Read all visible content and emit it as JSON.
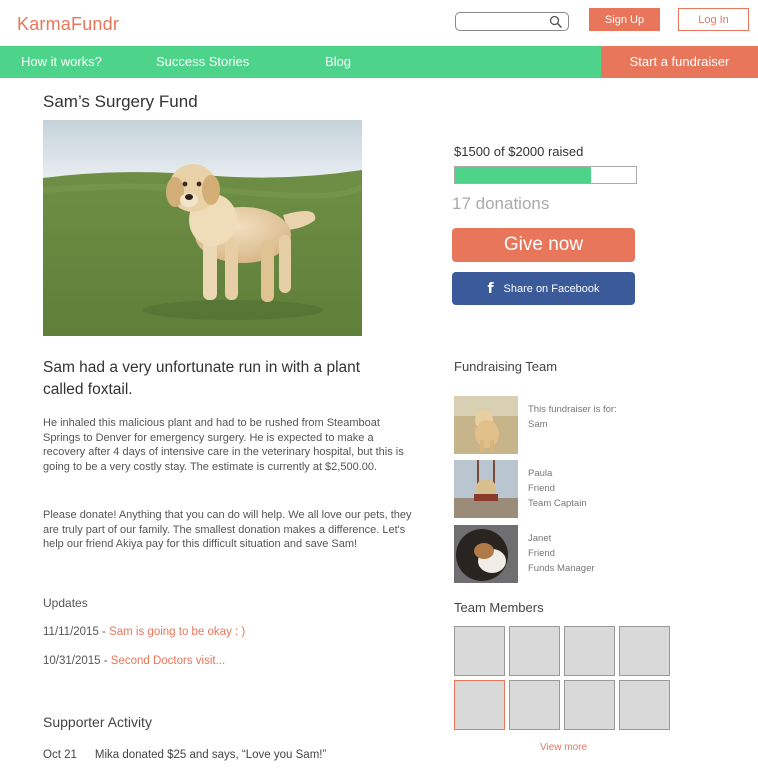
{
  "header": {
    "logo": "KarmaFundr",
    "search_placeholder": "",
    "signup_label": "Sign Up",
    "login_label": "Log In"
  },
  "nav": {
    "items": [
      "How it works?",
      "Success Stories",
      "Blog"
    ],
    "cta": "Start a fundraiser"
  },
  "campaign": {
    "title": "Sam’s Surgery Fund",
    "raised_text": "$1500 of $2000 raised",
    "progress_fraction": 0.75,
    "donations": "17 donations",
    "give_label": "Give now",
    "share_label": "Share on Facebook",
    "headline": "Sam had a very unfortunate run in with a plant called foxtail.",
    "paragraph1": "He inhaled this malicious plant and had to be rushed from Steamboat Springs to Denver for emergency surgery. He is expected to make a recovery after 4 days of intensive care in the veterinary hospital, but this is going to be a very costly stay. The estimate is currently at $2,500.00.",
    "paragraph2": "Please donate! Anything that you can do will help. We all love our pets, they are truly part of our family. The smallest donation makes a difference. Let's help our friend Akiya pay for this difficult situation and save Sam!"
  },
  "updates": {
    "heading": "Updates",
    "items": [
      {
        "date": "11/11/2015 - ",
        "title": "Sam is going to be okay : )"
      },
      {
        "date": "10/31/2015 - ",
        "title": "Second Doctors visit..."
      }
    ]
  },
  "supporter": {
    "heading": "Supporter Activity",
    "date": "Oct 21",
    "text": "Mika donated $25 and says, “Love you Sam!”"
  },
  "team": {
    "heading": "Fundraising Team",
    "members": [
      {
        "line1": "This fundraiser is for:",
        "line2": "Sam",
        "line3": ""
      },
      {
        "line1": "Paula",
        "line2": "Friend",
        "line3": "Team Captain"
      },
      {
        "line1": "Janet",
        "line2": "Friend",
        "line3": "Funds Manager"
      }
    ],
    "members_heading": "Team Members",
    "view_more": "View more"
  },
  "colors": {
    "brand_orange": "#e8765a",
    "brand_green": "#4dd48a",
    "facebook_blue": "#3b5a9a"
  }
}
